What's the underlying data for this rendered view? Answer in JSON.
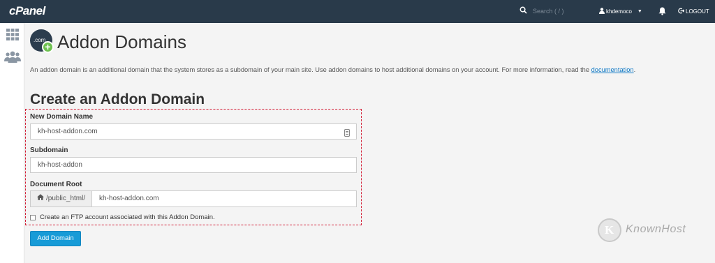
{
  "topbar": {
    "logo": "cPanel",
    "search_placeholder": "Search ( / )",
    "username": "khdemoco",
    "logout_label": "LOGOUT"
  },
  "header": {
    "icon_text": ".com",
    "title": "Addon Domains",
    "description": "An addon domain is an additional domain that the system stores as a subdomain of your main site. Use addon domains to host additional domains on your account. For more information, read the ",
    "doc_link": "documentation",
    "description_end": "."
  },
  "form": {
    "section_title": "Create an Addon Domain",
    "domain_label": "New Domain Name",
    "domain_value": "kh-host-addon.com",
    "subdomain_label": "Subdomain",
    "subdomain_value": "kh-host-addon",
    "docroot_label": "Document Root",
    "docroot_prefix": "/public_html/",
    "docroot_value": "kh-host-addon.com",
    "ftp_checkbox_label": "Create an FTP account associated with this Addon Domain.",
    "ftp_checked": false,
    "submit_label": "Add Domain"
  },
  "watermark": {
    "logo_letter": "K",
    "brand": "KnownHost"
  },
  "colors": {
    "topbar": "#293a4a",
    "button": "#179bd7",
    "highlight_border": "#d31d35",
    "link": "#0e78c5"
  }
}
